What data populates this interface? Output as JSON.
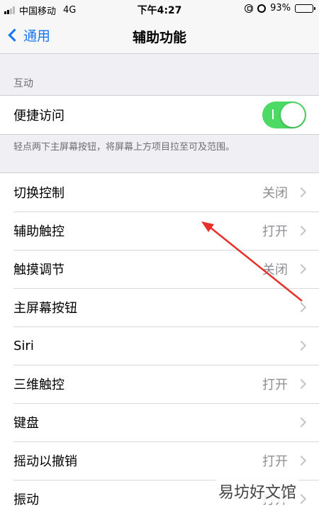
{
  "status": {
    "carrier": "中国移动",
    "network": "4G",
    "time": "下午4:27",
    "battery_percent": "93%",
    "battery_level": 0.93
  },
  "nav": {
    "back_label": "通用",
    "title": "辅助功能"
  },
  "interaction_section": {
    "header": "互动",
    "reachability_label": "便捷访问",
    "reachability_on": true,
    "note": "轻点两下主屏幕按钮，将屏幕上方项目拉至可及范围。"
  },
  "items": [
    {
      "label": "切换控制",
      "value": "关闭"
    },
    {
      "label": "辅助触控",
      "value": "打开"
    },
    {
      "label": "触摸调节",
      "value": "关闭"
    },
    {
      "label": "主屏幕按钮",
      "value": ""
    },
    {
      "label": "Siri",
      "value": ""
    },
    {
      "label": "三维触控",
      "value": "打开"
    },
    {
      "label": "键盘",
      "value": ""
    },
    {
      "label": "摇动以撤销",
      "value": "打开"
    },
    {
      "label": "振动",
      "value": "打开"
    }
  ],
  "watermark": "易坊好文馆",
  "colors": {
    "accent": "#1677f6",
    "toggle_on": "#4cd964",
    "annotation_arrow": "#e8302a"
  },
  "icons": {
    "back": "chevron-left-icon",
    "row": "chevron-right-icon",
    "status": [
      "signal-icon",
      "rotation-lock-icon",
      "alarm-icon",
      "battery-icon"
    ]
  }
}
